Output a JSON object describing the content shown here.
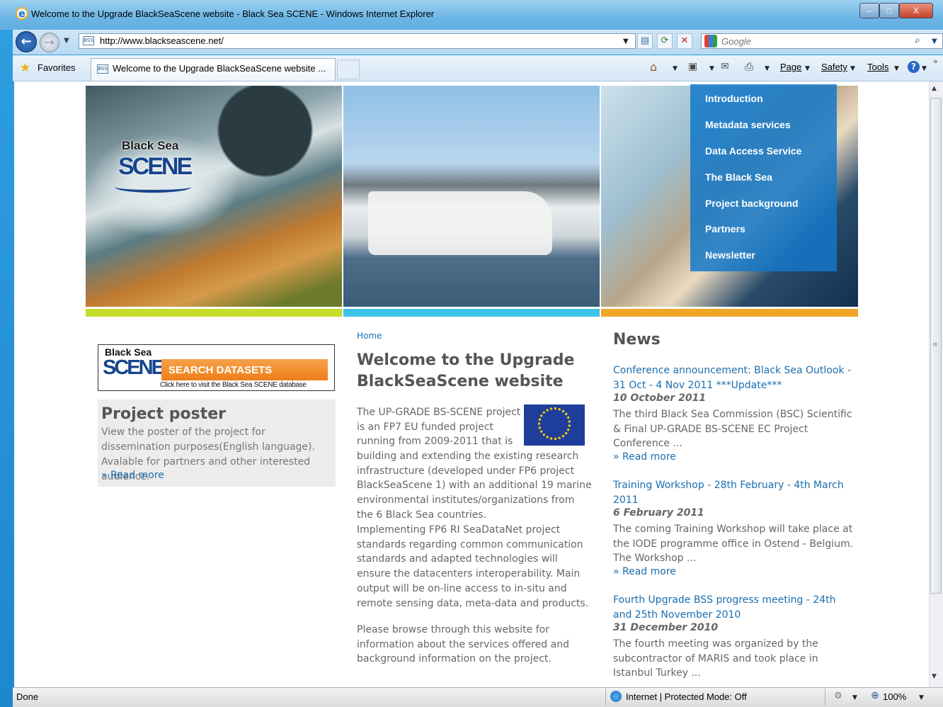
{
  "window": {
    "title": "Welcome to the Upgrade BlackSeaScene website - Black Sea SCENE - Windows Internet Explorer",
    "min": "–",
    "max": "□",
    "close": "X"
  },
  "nav": {
    "back": "←",
    "forward": "→",
    "url": "http://www.blackseascene.net/",
    "search_placeholder": "Google"
  },
  "favorites": {
    "label": "Favorites"
  },
  "tab": {
    "label": "Welcome to the Upgrade BlackSeaScene website ..."
  },
  "commands": {
    "page": "Page",
    "safety": "Safety",
    "tools": "Tools"
  },
  "site": {
    "brand_top": "Black Sea",
    "brand_bottom": "SCENE",
    "menu": [
      "Introduction",
      "Metadata services",
      "Data Access Service",
      "The Black Sea",
      "Project background",
      "Partners",
      "Newsletter"
    ]
  },
  "banner": {
    "brand_top": "Black Sea",
    "brand_bottom": "SCENE",
    "action": "SEARCH DATASETS",
    "subtext": "Click here to visit the Black Sea SCENE database"
  },
  "poster": {
    "title": "Project poster",
    "text": "View the poster of the project for dissemination purposes(English language). Avalable for partners and other interested audience.",
    "more": "» Read more"
  },
  "main": {
    "breadcrumb": "Home",
    "title": "Welcome to the Upgrade BlackSeaScene website",
    "para1_lines": [
      "The UP-GRADE BS-SCENE project",
      "is an FP7 EU funded project",
      "running from 2009-2011 that is"
    ],
    "para1_rest": "building and extending the existing research infrastructure (developed under FP6 project BlackSeaScene 1) with an additional 19 marine environmental institutes/organizations from the 6 Black Sea countries.",
    "para2": "Implementing FP6 RI SeaDataNet project standards regarding common communication standards and adapted technologies  will ensure the datacenters interoperability. Main output will be on-line access to in-situ and remote sensing data, meta-data and products.",
    "para3": "Please browse through this website for information about the services offered and background information on the project."
  },
  "news": {
    "title": "News",
    "items": [
      {
        "title": "Conference announcement: Black Sea Outlook - 31 Oct - 4 Nov 2011 ***Update***",
        "date": "10 October 2011",
        "body": "The third Black Sea Commission (BSC) Scientific & Final UP-GRADE BS-SCENE EC Project Conference ...",
        "more": "» Read more"
      },
      {
        "title": "Training Workshop - 28th February - 4th March 2011",
        "date": "6 February 2011",
        "body": "The coming Training Workshop will take place at the IODE programme office in Ostend - Belgium. The Workshop ...",
        "more": "» Read more"
      },
      {
        "title": "Fourth Upgrade BSS progress meeting - 24th and 25th November 2010",
        "date": "31 December 2010",
        "body": "The fourth meeting was organized by the subcontractor of MARIS and took place in Istanbul Turkey ...",
        "more": ""
      }
    ]
  },
  "status": {
    "left": "Done",
    "zone": "Internet | Protected Mode: Off",
    "zoom": "100%"
  }
}
